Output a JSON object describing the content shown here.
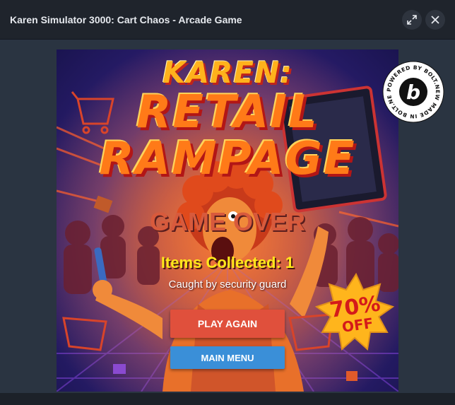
{
  "window": {
    "title": "Karen Simulator 3000: Cart Chaos - Arcade Game"
  },
  "icons": {
    "expand": "expand-icon",
    "close": "close-icon",
    "bolt_badge": "bolt-badge-icon"
  },
  "game": {
    "title_line1": "KAREN:",
    "title_line2": "RETAIL",
    "title_line3": "RAMPAGE",
    "game_over": "GAME OVER",
    "items_collected": "Items Collected: 1",
    "reason": "Caught by security guard",
    "play_again_label": "PLAY AGAIN",
    "main_menu_label": "MAIN MENU",
    "sale_percent": "70%",
    "sale_off": "OFF",
    "badge_text": "POWERED BY BOLT.NEW MADE IN BOLT.NEW",
    "badge_letter": "b"
  },
  "colors": {
    "play_again": "#e0503c",
    "main_menu": "#3a8fd8",
    "score_text": "#ffe81a",
    "game_over_text": "#d85a3c"
  }
}
